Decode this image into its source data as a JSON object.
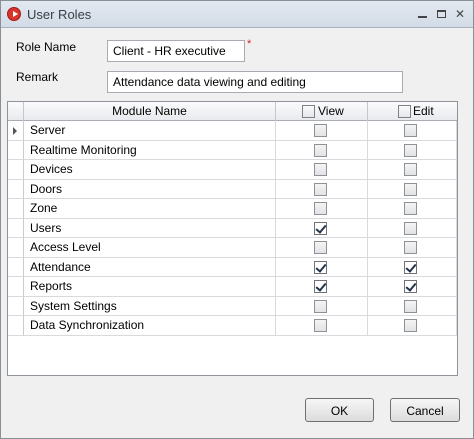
{
  "window": {
    "title": "User Roles"
  },
  "form": {
    "role_name_label": "Role Name",
    "role_name_value": "Client - HR executive",
    "required_marker": "*",
    "remark_label": "Remark",
    "remark_value": "Attendance data viewing and editing"
  },
  "grid": {
    "headers": {
      "module": "Module Name",
      "view": "View",
      "edit": "Edit"
    },
    "rows": [
      {
        "name": "Server",
        "view": false,
        "edit": false
      },
      {
        "name": "Realtime Monitoring",
        "view": false,
        "edit": false
      },
      {
        "name": "Devices",
        "view": false,
        "edit": false
      },
      {
        "name": "Doors",
        "view": false,
        "edit": false
      },
      {
        "name": "Zone",
        "view": false,
        "edit": false
      },
      {
        "name": "Users",
        "view": true,
        "edit": false
      },
      {
        "name": "Access Level",
        "view": false,
        "edit": false
      },
      {
        "name": "Attendance",
        "view": true,
        "edit": true
      },
      {
        "name": "Reports",
        "view": true,
        "edit": true
      },
      {
        "name": "System Settings",
        "view": false,
        "edit": false
      },
      {
        "name": "Data Synchronization",
        "view": false,
        "edit": false
      }
    ]
  },
  "buttons": {
    "ok": "OK",
    "cancel": "Cancel"
  }
}
